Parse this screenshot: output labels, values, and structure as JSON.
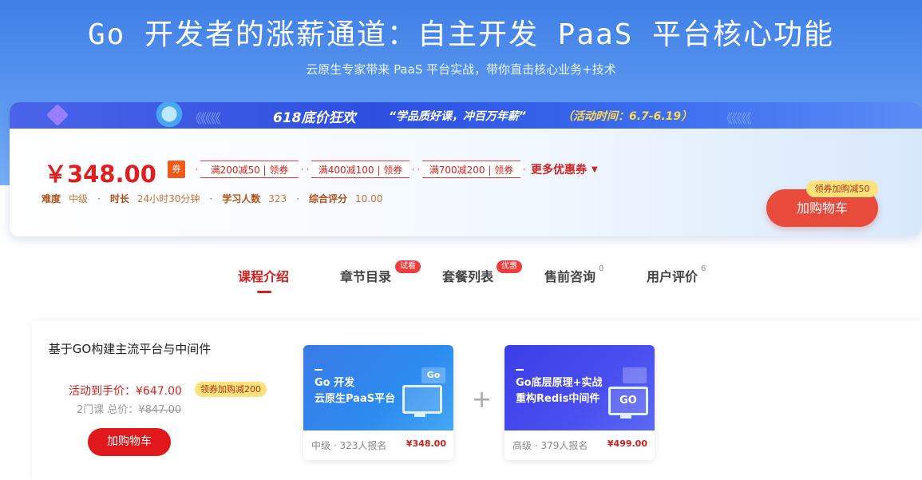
{
  "header": {
    "title": "Go 开发者的涨薪通道：自主开发 PaaS 平台核心功能",
    "subtitle": "云原生专家带来 PaaS 平台实战，带你直击核心业务+技术"
  },
  "banner": {
    "title": "618底价狂欢",
    "slogan": "“学品质好课，冲百万年薪”",
    "time": "（活动时间：6.7-6.19）",
    "arrows_left": "《《《《《",
    "arrows_right": "《《《《《"
  },
  "pricing": {
    "price": "￥348.00",
    "coupon_badge": "券",
    "coupons": [
      "满200减50 | 领券",
      "满400减100 | 领券",
      "满700减200 | 领券"
    ],
    "more_coupons": "更多优惠券",
    "cart_button": "加购物车",
    "cart_tag": "领券加购减50"
  },
  "meta": {
    "difficulty_label": "难度",
    "difficulty": "中级",
    "duration_label": "时长",
    "duration": "24小时30分钟",
    "learners_label": "学习人数",
    "learners": "323",
    "rating_label": "综合评分",
    "rating": "10.00"
  },
  "tabs": [
    {
      "label": "课程介绍",
      "active": true
    },
    {
      "label": "章节目录",
      "badge": "试看"
    },
    {
      "label": "套餐列表",
      "badge": "优惠"
    },
    {
      "label": "售前咨询",
      "count": "0"
    },
    {
      "label": "用户评价",
      "count": "6"
    }
  ],
  "package": {
    "name": "基于GO构建主流平台与中间件",
    "price_label": "活动到手价：¥647.00",
    "tag": "领券加购减200",
    "total_prefix": "2门课 总价：",
    "total_value": "¥847.00",
    "button": "加购物车",
    "plus": "+",
    "courses": [
      {
        "cover_line1": "Go 开发",
        "cover_line2": "云原生PaaS平台",
        "level": "中级 · 323人报名",
        "price": "¥348.00",
        "icon_label": "Go"
      },
      {
        "cover_line1": "Go底层原理+实战",
        "cover_line2": "重构Redis中间件",
        "level": "高级 · 379人报名",
        "price": "¥499.00",
        "icon_label": "GO"
      }
    ]
  },
  "colors": {
    "accent_red": "#e21d1d",
    "brand_blue": "#3f7fe6",
    "tag_yellow": "#ffe27a"
  }
}
